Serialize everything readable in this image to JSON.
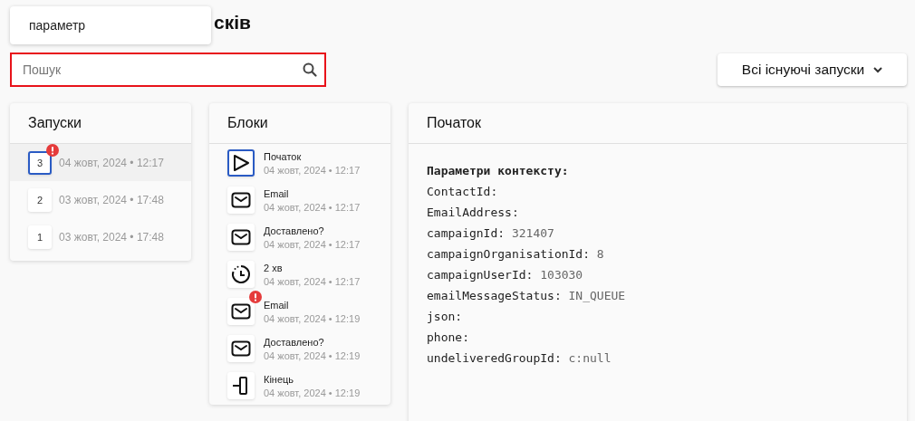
{
  "popup": {
    "text": "параметр"
  },
  "title": "сків",
  "search": {
    "placeholder": "Пошук"
  },
  "filter_button": {
    "label": "Всі існуючі запуски"
  },
  "runs": {
    "title": "Запуски",
    "items": [
      {
        "number": "3",
        "time": "04 жовт, 2024 • 12:17",
        "selected": true,
        "error": true
      },
      {
        "number": "2",
        "time": "03 жовт, 2024 • 17:48",
        "selected": false,
        "error": false
      },
      {
        "number": "1",
        "time": "03 жовт, 2024 • 17:48",
        "selected": false,
        "error": false
      }
    ]
  },
  "blocks": {
    "title": "Блоки",
    "items": [
      {
        "kind": "start",
        "name": "Початок",
        "time": "04 жовт, 2024 • 12:17",
        "selected": true,
        "error": false
      },
      {
        "kind": "email",
        "name": "Email",
        "time": "04 жовт, 2024 • 12:17",
        "selected": false,
        "error": false
      },
      {
        "kind": "email",
        "name": "Доставлено?",
        "time": "04 жовт, 2024 • 12:17",
        "selected": false,
        "error": false
      },
      {
        "kind": "timer",
        "name": "2 хв",
        "time": "04 жовт, 2024 • 12:17",
        "selected": false,
        "error": false
      },
      {
        "kind": "email",
        "name": "Email",
        "time": "04 жовт, 2024 • 12:19",
        "selected": false,
        "error": true
      },
      {
        "kind": "email",
        "name": "Доставлено?",
        "time": "04 жовт, 2024 • 12:19",
        "selected": false,
        "error": false
      },
      {
        "kind": "end",
        "name": "Кінець",
        "time": "04 жовт, 2024 • 12:19",
        "selected": false,
        "error": false
      }
    ]
  },
  "detail": {
    "title": "Початок",
    "heading": "Параметри контексту:",
    "params": [
      {
        "key": "ContactId:"
      },
      {
        "key": "EmailAddress:"
      },
      {
        "key": "campaignId:",
        "value": "321407"
      },
      {
        "key": "campaignOrganisationId:",
        "value": "8"
      },
      {
        "key": "campaignUserId:",
        "value": "103030"
      },
      {
        "key": "emailMessageStatus:",
        "value": "IN_QUEUE"
      },
      {
        "key": "json:"
      },
      {
        "key": "phone:"
      },
      {
        "key": "undeliveredGroupId:",
        "value": "c:null"
      }
    ]
  }
}
